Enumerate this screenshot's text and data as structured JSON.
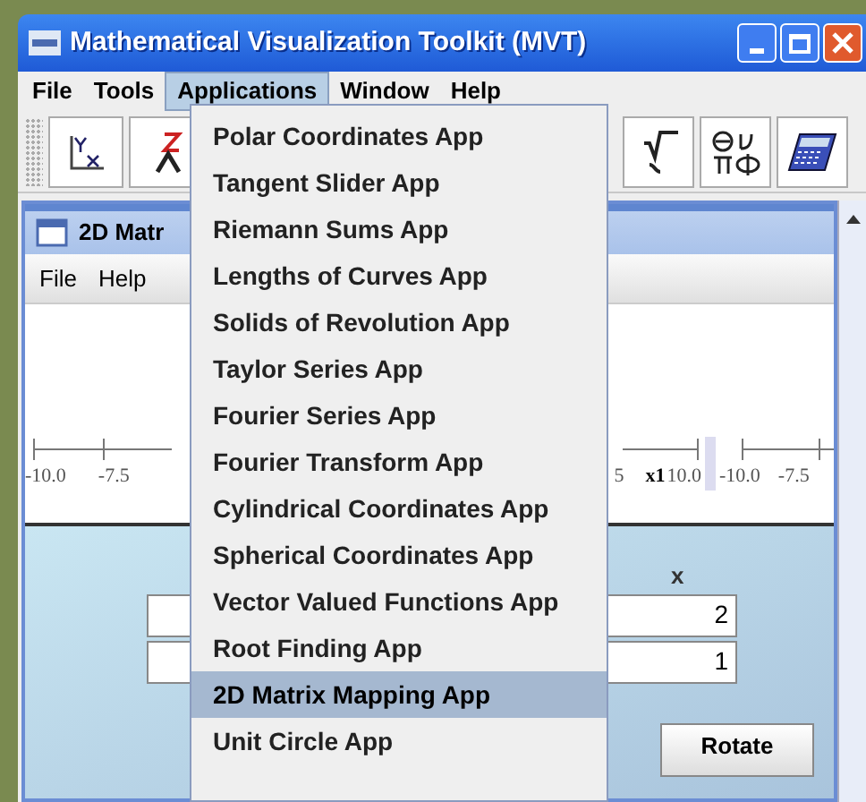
{
  "window": {
    "title": "Mathematical Visualization Toolkit (MVT)"
  },
  "menu_bar": [
    {
      "label": "File",
      "selected": false
    },
    {
      "label": "Tools",
      "selected": false
    },
    {
      "label": "Applications",
      "selected": true
    },
    {
      "label": "Window",
      "selected": false
    },
    {
      "label": "Help",
      "selected": false
    }
  ],
  "applications_menu": [
    {
      "label": "Polar Coordinates App",
      "selected": false
    },
    {
      "label": "Tangent Slider App",
      "selected": false
    },
    {
      "label": "Riemann Sums App",
      "selected": false
    },
    {
      "label": "Lengths of Curves App",
      "selected": false
    },
    {
      "label": "Solids of Revolution App",
      "selected": false
    },
    {
      "label": "Taylor Series App",
      "selected": false
    },
    {
      "label": "Fourier Series App",
      "selected": false
    },
    {
      "label": "Fourier Transform App",
      "selected": false
    },
    {
      "label": "Cylindrical Coordinates App",
      "selected": false
    },
    {
      "label": "Spherical Coordinates App",
      "selected": false
    },
    {
      "label": "Vector Valued Functions App",
      "selected": false
    },
    {
      "label": "Root Finding App",
      "selected": false
    },
    {
      "label": "2D Matrix Mapping App",
      "selected": true
    },
    {
      "label": "Unit Circle App",
      "selected": false
    }
  ],
  "inner_window": {
    "title": "2D Matr",
    "menu_bar": [
      "File",
      "Help"
    ],
    "left_axis": {
      "ticks": [
        "-10.0",
        "-7.5"
      ]
    },
    "right_axis": {
      "ticks": [
        "5",
        "10.0",
        "-10.0",
        "-7.5"
      ],
      "axis_label": "x1"
    },
    "matrix": {
      "column_header": "x",
      "values": [
        "2",
        "1"
      ]
    },
    "rotate_button": "Rotate"
  }
}
